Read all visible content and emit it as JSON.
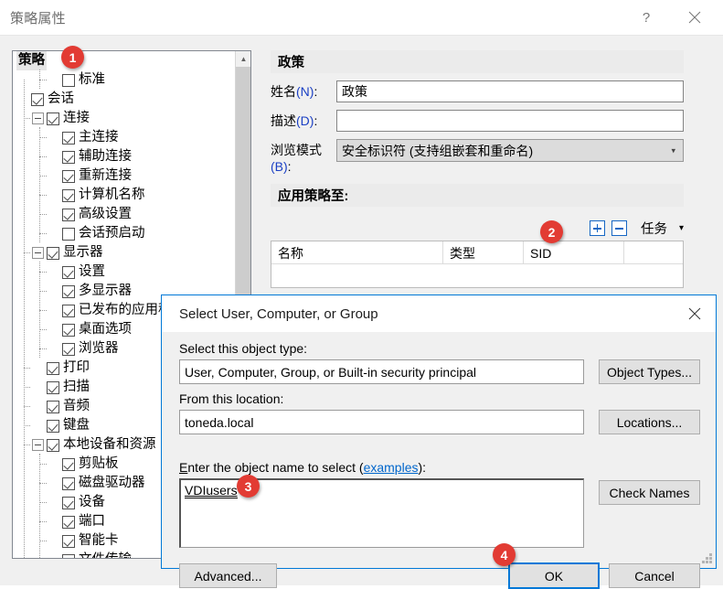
{
  "window": {
    "title": "策略属性",
    "help_icon": "?",
    "close_icon": "✕"
  },
  "tree": {
    "root_label": "策略",
    "items": [
      {
        "label": "策略",
        "depth": 0,
        "type": "root",
        "checked": null,
        "expander": null
      },
      {
        "label": "标准",
        "depth": 2,
        "type": "leaf",
        "checked": false,
        "expander": null
      },
      {
        "label": "会话",
        "depth": 0,
        "type": "node",
        "checked": true,
        "expander": null
      },
      {
        "label": "连接",
        "depth": 1,
        "type": "node",
        "checked": true,
        "expander": "minus"
      },
      {
        "label": "主连接",
        "depth": 2,
        "type": "leaf",
        "checked": true,
        "expander": null
      },
      {
        "label": "辅助连接",
        "depth": 2,
        "type": "leaf",
        "checked": true,
        "expander": null
      },
      {
        "label": "重新连接",
        "depth": 2,
        "type": "leaf",
        "checked": true,
        "expander": null
      },
      {
        "label": "计算机名称",
        "depth": 2,
        "type": "leaf",
        "checked": true,
        "expander": null
      },
      {
        "label": "高级设置",
        "depth": 2,
        "type": "leaf",
        "checked": true,
        "expander": null
      },
      {
        "label": "会话预启动",
        "depth": 2,
        "type": "leaf",
        "checked": false,
        "expander": null
      },
      {
        "label": "显示器",
        "depth": 1,
        "type": "node",
        "checked": true,
        "expander": "minus"
      },
      {
        "label": "设置",
        "depth": 2,
        "type": "leaf",
        "checked": true,
        "expander": null
      },
      {
        "label": "多显示器",
        "depth": 2,
        "type": "leaf",
        "checked": true,
        "expander": null
      },
      {
        "label": "已发布的应用程序",
        "depth": 2,
        "type": "leaf",
        "checked": true,
        "expander": null
      },
      {
        "label": "桌面选项",
        "depth": 2,
        "type": "leaf",
        "checked": true,
        "expander": null
      },
      {
        "label": "浏览器",
        "depth": 2,
        "type": "leaf",
        "checked": true,
        "expander": null
      },
      {
        "label": "打印",
        "depth": 1,
        "type": "leaf",
        "checked": true,
        "expander": null
      },
      {
        "label": "扫描",
        "depth": 1,
        "type": "leaf",
        "checked": true,
        "expander": null
      },
      {
        "label": "音频",
        "depth": 1,
        "type": "leaf",
        "checked": true,
        "expander": null
      },
      {
        "label": "键盘",
        "depth": 1,
        "type": "leaf",
        "checked": true,
        "expander": null
      },
      {
        "label": "本地设备和资源",
        "depth": 1,
        "type": "node",
        "checked": true,
        "expander": "minus"
      },
      {
        "label": "剪贴板",
        "depth": 2,
        "type": "leaf",
        "checked": true,
        "expander": null
      },
      {
        "label": "磁盘驱动器",
        "depth": 2,
        "type": "leaf",
        "checked": true,
        "expander": null
      },
      {
        "label": "设备",
        "depth": 2,
        "type": "leaf",
        "checked": true,
        "expander": null
      },
      {
        "label": "端口",
        "depth": 2,
        "type": "leaf",
        "checked": true,
        "expander": null
      },
      {
        "label": "智能卡",
        "depth": 2,
        "type": "leaf",
        "checked": true,
        "expander": null
      },
      {
        "label": "文件传输",
        "depth": 2,
        "type": "leaf",
        "checked": true,
        "expander": null
      }
    ]
  },
  "form": {
    "section_title": "政策",
    "name_label": "姓名(N):",
    "name_value": "政策",
    "desc_label": "描述(D):",
    "desc_value": "",
    "browse_label": "浏览模式(B):",
    "browse_value": "安全标识符 (支持组嵌套和重命名)",
    "apply_to_title": "应用策略至:",
    "add_icon": "plus-icon",
    "remove_icon": "minus-icon",
    "tasks_label": "任务",
    "tasks_caret": "▾",
    "grid_columns": [
      "名称",
      "类型",
      "SID"
    ],
    "grid_rows": []
  },
  "dialog": {
    "title": "Select User, Computer, or Group",
    "close_icon": "✕",
    "object_type_label": "Select this object type:",
    "object_type_value": "User, Computer, Group, or Built-in security principal",
    "object_types_button": "Object Types...",
    "location_label": "From this location:",
    "location_value": "toneda.local",
    "locations_button": "Locations...",
    "objname_label_pre": "E",
    "objname_label_mid": "nter the object name to select (",
    "objname_link": "examples",
    "objname_label_post": "):",
    "objname_value": "VDIusers",
    "check_names_button": "Check Names",
    "advanced_button": "Advanced...",
    "ok_button": "OK",
    "cancel_button": "Cancel"
  },
  "badges": {
    "one": "1",
    "two": "2",
    "three": "3",
    "four": "4"
  },
  "colors": {
    "badge_red": "#e23b33",
    "accent_blue": "#0078d7",
    "toolbar_blue": "#1667c4",
    "link_blue": "#0066cc"
  }
}
